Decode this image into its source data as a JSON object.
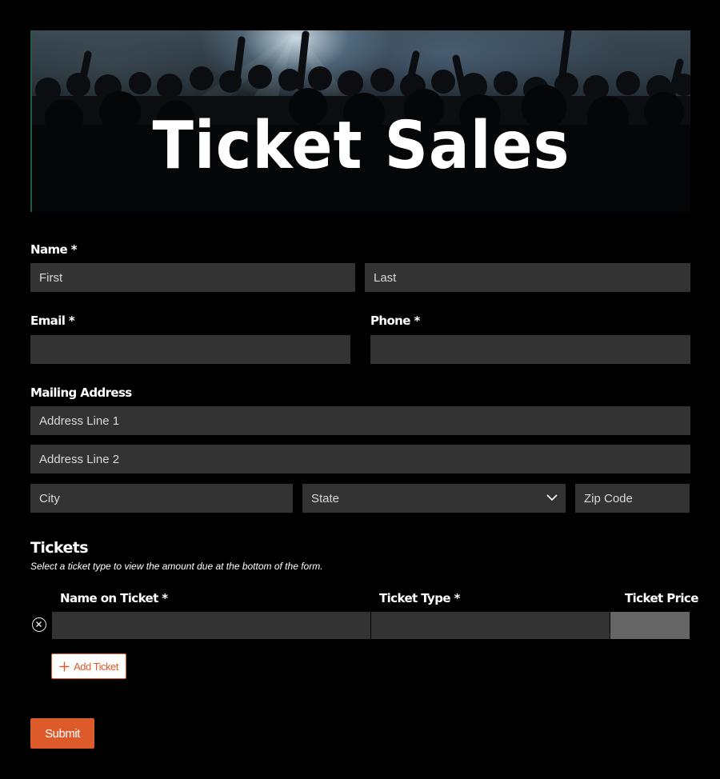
{
  "banner": {
    "title": "Ticket Sales"
  },
  "name": {
    "label": "Name *",
    "first_placeholder": "First",
    "last_placeholder": "Last"
  },
  "email": {
    "label": "Email *",
    "value": ""
  },
  "phone": {
    "label": "Phone *",
    "value": ""
  },
  "address": {
    "label": "Mailing Address",
    "line1_placeholder": "Address Line 1",
    "line2_placeholder": "Address Line 2",
    "city_placeholder": "City",
    "state_placeholder": "State",
    "zip_placeholder": "Zip Code"
  },
  "tickets": {
    "title": "Tickets",
    "description": "Select a ticket type to view the amount due at the bottom of the form.",
    "columns": [
      "Name on Ticket *",
      "Ticket Type *",
      "Ticket Price"
    ],
    "add_label": "Add Ticket"
  },
  "submit_label": "Submit",
  "colors": {
    "accent": "#dd5a2b",
    "field_bg": "#333333",
    "price_bg": "#666666",
    "page_bg": "#000000"
  },
  "icons": {
    "remove": "circle-x-icon",
    "add": "plus-icon",
    "state_dropdown": "chevron-down-icon"
  }
}
